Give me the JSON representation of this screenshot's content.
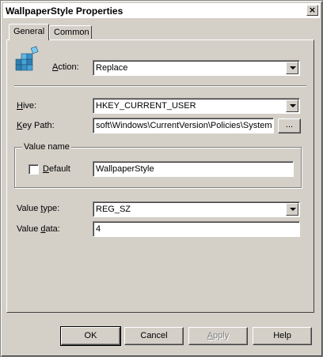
{
  "window": {
    "title": "WallpaperStyle Properties",
    "close_glyph": "×"
  },
  "tabs": [
    {
      "label": "General",
      "active": true
    },
    {
      "label": "Common",
      "active": false
    }
  ],
  "action": {
    "label_prefix": "",
    "label_ul": "A",
    "label_rest": "ction:",
    "value": "Replace"
  },
  "hive": {
    "label_ul": "H",
    "label_rest": "ive:",
    "value": "HKEY_CURRENT_USER"
  },
  "key_path": {
    "label_ul": "K",
    "label_rest": "ey Path:",
    "value": "soft\\Windows\\CurrentVersion\\Policies\\System",
    "browse_label": "..."
  },
  "value_name": {
    "group_label": "Value name",
    "default_label_ul": "D",
    "default_label_rest": "efault",
    "default_checked": false,
    "value": "WallpaperStyle"
  },
  "value_type": {
    "label_prefix": "Value ",
    "label_ul": "t",
    "label_rest": "ype:",
    "value": "REG_SZ"
  },
  "value_data": {
    "label_prefix": "Value ",
    "label_ul": "d",
    "label_rest": "ata:",
    "value": "4"
  },
  "buttons": {
    "ok": "OK",
    "cancel": "Cancel",
    "apply_ul": "A",
    "apply_rest": "pply",
    "help": "Help"
  }
}
